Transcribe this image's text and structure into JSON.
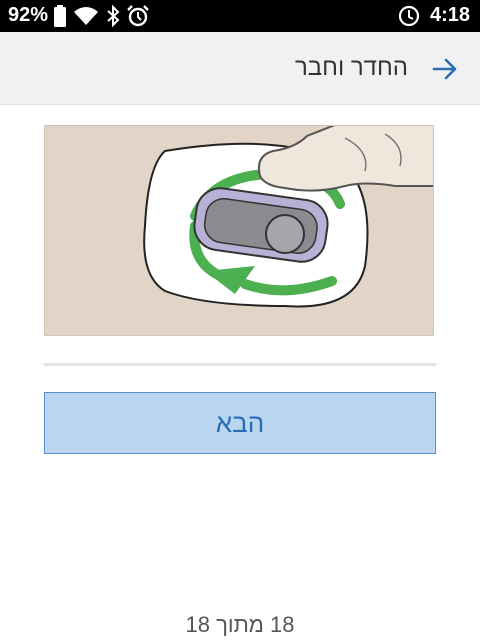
{
  "status_bar": {
    "battery_percent": "92%",
    "time": "4:18",
    "icons": [
      "battery-icon",
      "wifi-icon",
      "bluetooth-icon",
      "alarm-icon",
      "data-saver-icon"
    ]
  },
  "header": {
    "title": "החדר וחבר",
    "back_icon": "arrow-right-icon",
    "accent_color": "#2b6cb5",
    "background": "#f1f1f3"
  },
  "illustration": {
    "subject": "sensor-insert-twist-illustration",
    "background": "#e2d4c6",
    "arrow_color": "#4caf50"
  },
  "actions": {
    "next_label": "הבא",
    "button_background": "#b9d5f0",
    "button_border": "#5b8fc9"
  },
  "footer": {
    "step_text": "18 מתוך 18"
  }
}
